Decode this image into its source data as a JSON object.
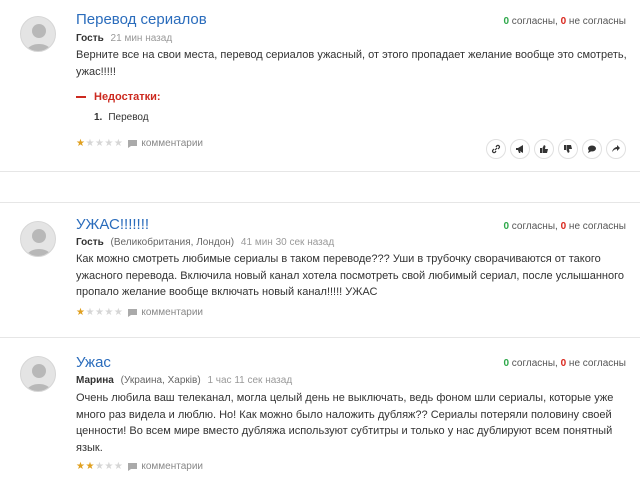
{
  "reviews": [
    {
      "title": "Перевод сериалов",
      "author": "Гость",
      "location": "",
      "time": "21 мин назад",
      "agree_count": "0",
      "agree_label": "согласны,",
      "disagree_count": "0",
      "disagree_label": "не согласны",
      "text": "Верните все на свои места, перевод сериалов ужасный, от этого пропадает желание вообще это смотреть, ужас!!!!!",
      "cons_heading": "Недостатки:",
      "cons": [
        {
          "num": "1.",
          "text": "Перевод"
        }
      ],
      "rating": 1,
      "comments_label": "комментарии"
    },
    {
      "title": "УЖАС!!!!!!!",
      "author": "Гость",
      "location": "(Великобритания, Лондон)",
      "time": "41 мин 30 сек назад",
      "agree_count": "0",
      "agree_label": "согласны,",
      "disagree_count": "0",
      "disagree_label": "не согласны",
      "text": "Как можно смотреть любимые сериалы в таком переводе??? Уши в трубочку сворачиваются от такого ужасного перевода. Включила новый канал хотела посмотреть свой любимый сериал, после услышанного пропало желание вообще включать новый канал!!!!! УЖАС",
      "rating": 1,
      "comments_label": "комментарии"
    },
    {
      "title": "Ужас",
      "author": "Марина",
      "location": "(Украина, Харків)",
      "time": "1 час 11 сек назад",
      "agree_count": "0",
      "agree_label": "согласны,",
      "disagree_count": "0",
      "disagree_label": "не согласны",
      "text": "Очень любила ваш телеканал, могла целый день не выключать, ведь фоном шли сериалы, которые уже много раз видела и люблю. Но! Как можно было наложить дубляж?? Сериалы потеряли половину своей ценности! Во всем мире вместо дубляжа используют субтитры и только у нас дублируют всем понятный язык.",
      "rating": 2,
      "comments_label": "комментарии"
    }
  ],
  "actions": [
    "link-icon",
    "megaphone-icon",
    "thumbs-up-icon",
    "thumbs-down-icon",
    "comment-icon",
    "share-icon"
  ],
  "colors": {
    "title": "#2a6cbc",
    "agree": "#2ea84a",
    "disagree": "#d9261c",
    "star": "#e0a020",
    "cons": "#cc2a20"
  }
}
